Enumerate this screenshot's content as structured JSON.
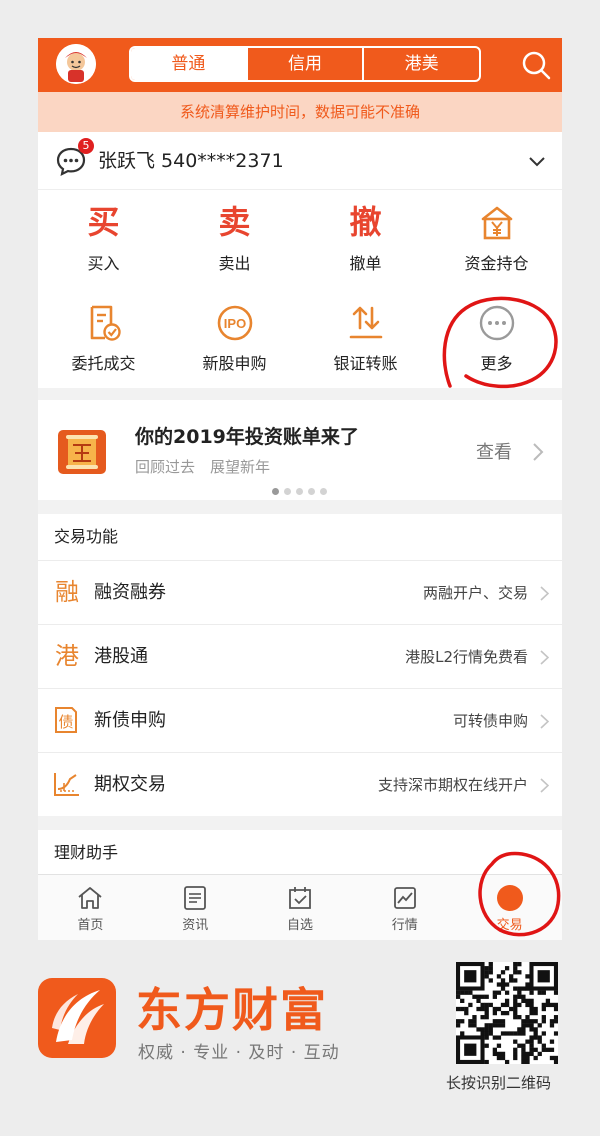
{
  "header": {
    "tabs": [
      "普通",
      "信用",
      "港美"
    ],
    "active_tab": "普通"
  },
  "notice": "系统清算维护时间，数据可能不准确",
  "account": {
    "message_count": "5",
    "name": "张跃飞 540****2371"
  },
  "grid": {
    "row1": [
      {
        "glyph": "买",
        "label": "买入"
      },
      {
        "glyph": "卖",
        "label": "卖出"
      },
      {
        "glyph": "撤",
        "label": "撤单"
      },
      {
        "icon": "fund-position-icon",
        "label": "资金持仓"
      }
    ],
    "row2": [
      {
        "icon": "order-deal-icon",
        "label": "委托成交"
      },
      {
        "icon": "ipo-icon",
        "icon_text": "IPO",
        "label": "新股申购"
      },
      {
        "icon": "bank-transfer-icon",
        "label": "银证转账"
      },
      {
        "icon": "more-icon",
        "label": "更多"
      }
    ]
  },
  "banner": {
    "title": "你的2019年投资账单来了",
    "subtitle": "回顾过去　展望新年",
    "link": "查看",
    "dots_total": 5,
    "dots_active": 0
  },
  "trade_section": {
    "title": "交易功能",
    "rows": [
      {
        "icon_glyph": "融",
        "label": "融资融券",
        "note": "两融开户、交易"
      },
      {
        "icon_glyph": "港",
        "label": "港股通",
        "note": "港股L2行情免费看"
      },
      {
        "icon": "bond-icon",
        "icon_glyph": "债",
        "label": "新债申购",
        "note": "可转债申购"
      },
      {
        "icon": "option-icon",
        "label": "期权交易",
        "note": "支持深市期权在线开户"
      }
    ]
  },
  "wealth_section": {
    "title": "理财助手"
  },
  "tabbar": {
    "items": [
      {
        "icon": "home-icon",
        "label": "首页"
      },
      {
        "icon": "news-icon",
        "label": "资讯"
      },
      {
        "icon": "watchlist-icon",
        "label": "自选"
      },
      {
        "icon": "market-icon",
        "label": "行情"
      },
      {
        "icon": "trade-icon",
        "glyph": "¥",
        "label": "交易"
      }
    ],
    "active": "交易"
  },
  "brand": {
    "name": "东方财富",
    "slogan": "权威 · 专业 · 及时 · 互动",
    "qr_caption": "长按识别二维码"
  },
  "colors": {
    "brand": "#f05a1c",
    "notice_bg": "#fbd6c3",
    "buy_red": "#e8452f",
    "icon_orange": "#e8852f",
    "annotation_red": "#e01515"
  }
}
